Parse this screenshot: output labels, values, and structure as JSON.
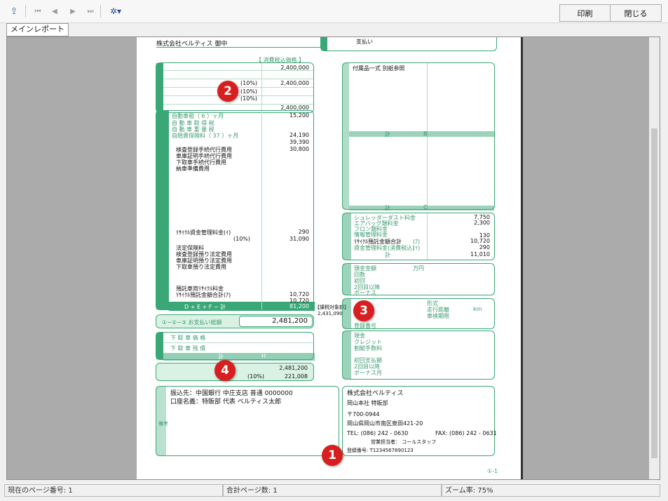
{
  "toolbar": {
    "print_label": "印刷",
    "close_label": "閉じる"
  },
  "tab": {
    "label": "メインレポート"
  },
  "document": {
    "header_left": "株式会社ベルティス 御中",
    "header_note": "【 消費税込価格 】",
    "top_right_value": "支払い",
    "vehicle_price": "2,400,000",
    "vehicle_subtotal": "2,400,000",
    "vehicle_total": "2,400,000",
    "tax_rate_1": "(10%)",
    "tax_rate_2": "(10%)",
    "tax_rate_3": "(10%)",
    "auto_tax_label": "自動車税（ 6 ）ヶ月",
    "auto_tax_value": "15,200",
    "weight_tax_label": "自 動 車 取 得 税",
    "weight_tax_label2": "自 動 車 重 量 税",
    "insurance_label": "自賠責保険料（ 37 ）ヶ月",
    "insurance_value": "24,190",
    "tax_subtotal": "39,390",
    "fees_value": "30,800",
    "fee_item_1": "検査登録手続代行費用",
    "fee_item_2": "車庫証明手続代行費用",
    "fee_item_3": "下取車手続代行費用",
    "fee_item_4": "納車準備費用",
    "recycle_mgmt_label": "ﾘｻｲｸﾙ資金管理料金(ｲ)",
    "recycle_mgmt_value": "290",
    "fees_tax": "(10%)",
    "fees_total": "31,090",
    "stamp_item_0": "法定保険料",
    "stamp_item_1": "検査登録預り法定費用",
    "stamp_item_2": "車庫証明預り法定費用",
    "stamp_item_3": "下取車預り法定費用",
    "recycle_deposit_label": "預託車両ﾘｻｲｸﾙ料金",
    "recycle_deposit_total_label": "ﾘｻｲｸﾙ預託金額合計(ｱ)",
    "recycle_deposit_value": "10,720",
    "recycle_deposit_sum": "10,720",
    "dfeg_label": "D + E + F − 計",
    "dfeg_value": "81,200",
    "payment_total_label": "①−②−③ お支払い総額",
    "payment_total_value": "2,481,200",
    "trade_in_row1": "下 取 車 価 格",
    "trade_in_row2": "下 取 車 残 債",
    "trade_in_total": "計",
    "trade_in_code": "H",
    "final_total_value": "2,481,200",
    "final_tax_rate": "(10%)",
    "final_tax_value": "221,008",
    "tax_note_label": "【課税対象額】",
    "tax_note_value": "2,431,090",
    "accessory_label": "付属品一式 別紙参照",
    "accessory_total": "計",
    "accessory_code": "B",
    "special_total": "計",
    "special_code": "C",
    "shredder_label": "シュレッダーダスト料金",
    "shredder_value": "7,750",
    "airbag_label": "エアバッグ類料金",
    "airbag_value": "2,300",
    "freon_label": "フロン類料金",
    "info_label": "情報管理料金",
    "info_value": "130",
    "recycle_total_label": "ﾘｻｲｸﾙ預託金額合計",
    "recycle_total_code": "(ｱ)",
    "recycle_total_value": "10,720",
    "mgmt_fee_label": "資金管理料金(消費税込)",
    "mgmt_fee_code": "(ｲ)",
    "mgmt_fee_value": "290",
    "recycle_sum_label": "計",
    "recycle_sum_value": "11,010",
    "installment_labels": [
      "頭金金額",
      "回数",
      "初回",
      "2回目以降",
      "ボーナス"
    ],
    "unit_yen": "万円",
    "vehicle_info_labels": [
      "形式",
      "走行距離",
      "車検期限"
    ],
    "km_label": "km",
    "reg_label": "登録番号",
    "payment_labels": [
      "現金",
      "クレジット",
      "割賦手数料"
    ],
    "other_labels": [
      "初回支払額",
      "2回目以降",
      "ボーナス月"
    ],
    "bank_line1": "振込先：中国銀行 中庄支店 普通 0000000",
    "bank_line2": "口座名義：特販部 代表 ベルティス太郎",
    "remarks_side": "備考",
    "company_name": "株式会社ベルティス",
    "company_branch": "岡山本社 特販部",
    "company_zip": "〒700-0944",
    "company_address": "岡山県岡山市南区泉田421-20",
    "company_tel": "TEL: (086) 242 - 0630",
    "company_fax": "FAX: (086) 242 - 0631",
    "company_rep": "営業担当者： コールスタッフ",
    "company_regno": "登録番号: T1234567890123",
    "page_footer": "①-1"
  },
  "markers": [
    "1",
    "2",
    "3",
    "4"
  ],
  "status": {
    "current_page": "現在のページ番号: 1",
    "total_pages": "合計ページ数: 1",
    "zoom": "ズーム率: 75%"
  }
}
